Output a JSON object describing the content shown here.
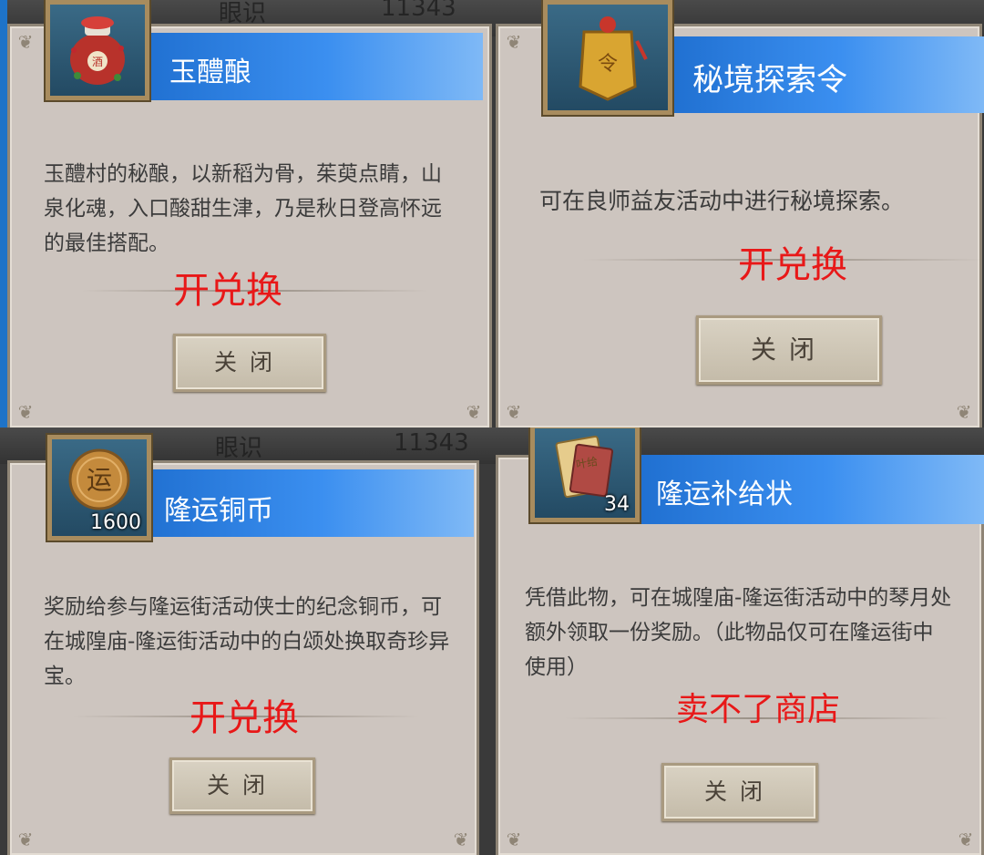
{
  "background": {
    "label": "眼识",
    "number": "11343"
  },
  "cards": [
    {
      "item_name": "玉醴酿",
      "icon": "wine-jar-icon",
      "quantity": "",
      "description": "玉醴村的秘酿，以新稻为骨，茱萸点睛，山泉化魂，入口酸甜生津，乃是秋日登高怀远的最佳搭配。",
      "annotation": "开兑换",
      "close_label": "关闭"
    },
    {
      "item_name": "秘境探索令",
      "icon": "token-plaque-icon",
      "quantity": "",
      "description": "可在良师益友活动中进行秘境探索。",
      "annotation": "开兑换",
      "close_label": "关闭"
    },
    {
      "item_name": "隆运铜币",
      "icon": "copper-coin-icon",
      "quantity": "1600",
      "description": "奖励给参与隆运街活动侠士的纪念铜币，可在城隍庙-隆运街活动中的白颂处换取奇珍异宝。",
      "annotation": "开兑换",
      "close_label": "关闭"
    },
    {
      "item_name": "隆运补给状",
      "icon": "supply-scroll-icon",
      "quantity": "34",
      "description": "凭借此物，可在城隍庙-隆运街活动中的琴月处额外领取一份奖励。（此物品仅可在隆运街中使用）",
      "annotation": "卖不了商店",
      "close_label": "关闭"
    }
  ]
}
